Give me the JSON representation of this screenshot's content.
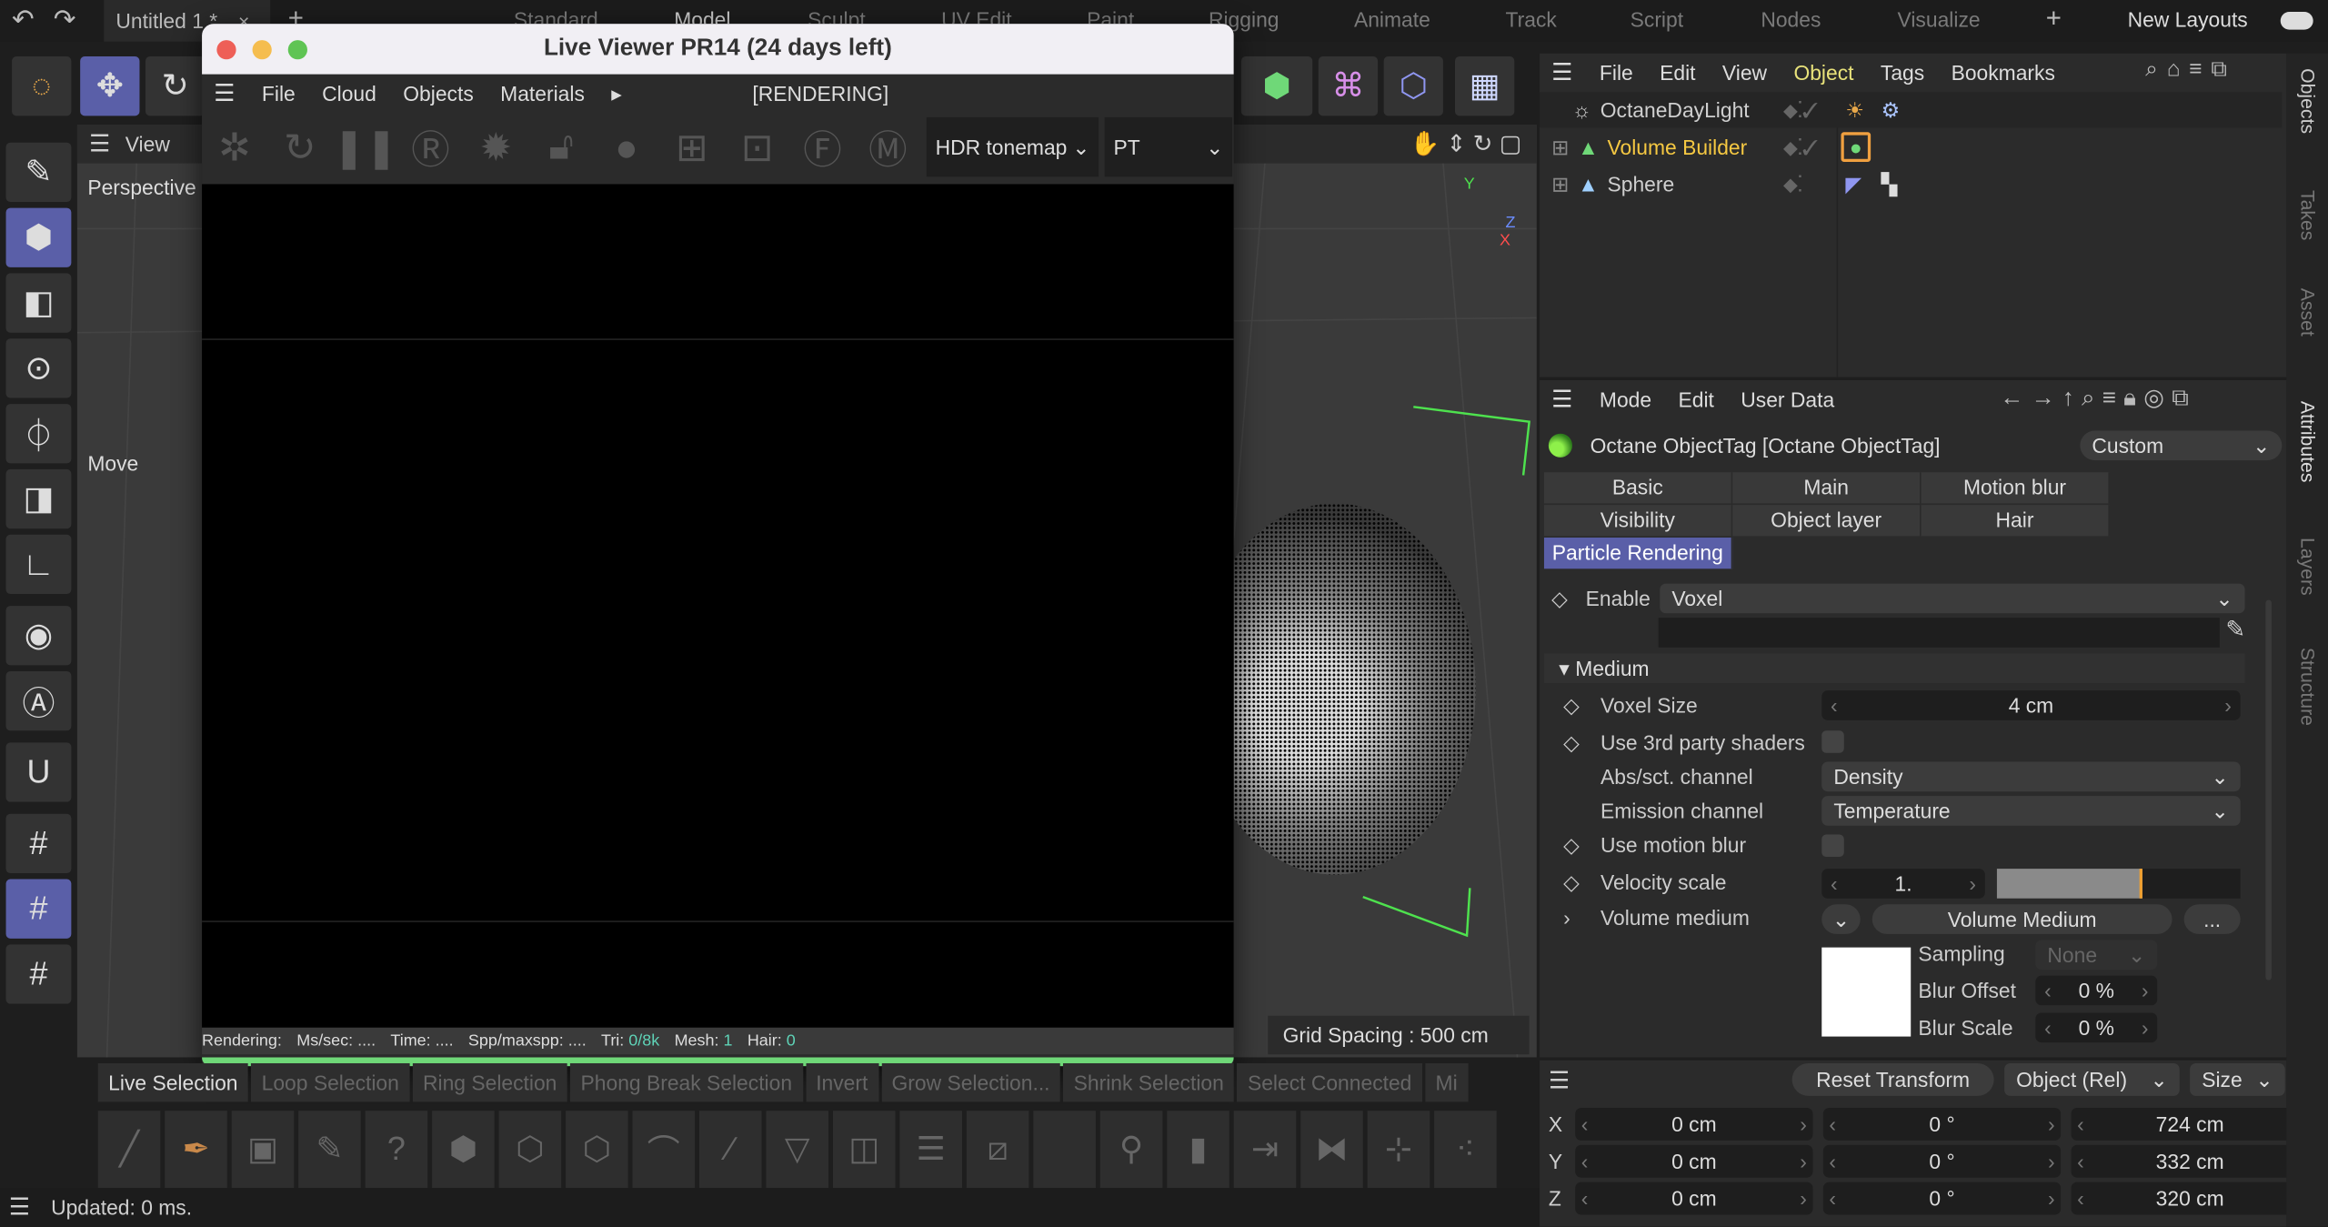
{
  "topbar": {
    "doc_tab": "Untitled 1 *",
    "layouts": [
      "Standard",
      "Model",
      "Sculpt",
      "UV Edit",
      "Paint",
      "Rigging",
      "Animate",
      "Track",
      "Script",
      "Nodes",
      "Visualize"
    ],
    "new_layouts": "New Layouts"
  },
  "viewport": {
    "menu": "View",
    "camera": "Perspective",
    "move_label": "Move",
    "grid_spacing": "Grid Spacing : 500 cm",
    "axis_y": "Y",
    "axis_z": "Z",
    "axis_x": "X"
  },
  "live_viewer": {
    "title": "Live Viewer PR14 (24 days left)",
    "menu": [
      "File",
      "Cloud",
      "Objects",
      "Materials"
    ],
    "state": "[RENDERING]",
    "tonemap": "HDR tonemap",
    "kernel": "PT",
    "status": {
      "rendering": "Rendering:",
      "mssec": "Ms/sec: ....",
      "time": "Time: ....",
      "spp": "Spp/maxspp: ....",
      "tri_label": "Tri:",
      "tri": "0/8k",
      "mesh_label": "Mesh:",
      "mesh": "1",
      "hair_label": "Hair:",
      "hair": "0"
    },
    "progress": 1.0
  },
  "selection_bar": [
    "Live Selection",
    "Loop Selection",
    "Ring Selection",
    "Phong Break Selection",
    "Invert",
    "Grow Selection...",
    "Shrink Selection",
    "Select Connected",
    "Mi"
  ],
  "status_bar": "Updated: 0 ms.",
  "object_manager": {
    "menu": [
      "File",
      "Edit",
      "View",
      "Object",
      "Tags",
      "Bookmarks"
    ],
    "active_menu": "Object",
    "objects": [
      {
        "name": "OctaneDayLight"
      },
      {
        "name": "Volume Builder",
        "selected": true
      },
      {
        "name": "Sphere"
      }
    ]
  },
  "attributes": {
    "menu": [
      "Mode",
      "Edit",
      "User Data"
    ],
    "title": "Octane ObjectTag [Octane ObjectTag]",
    "preset": "Custom",
    "tabs": [
      "Basic",
      "Main",
      "Motion blur",
      "Visibility",
      "Object layer",
      "Hair",
      "Particle Rendering"
    ],
    "active_tab": "Particle Rendering",
    "enable_label": "Enable",
    "enable_value": "Voxel",
    "section": "Medium",
    "voxel_size_label": "Voxel Size",
    "voxel_size": "4 cm",
    "third_party_label": "Use 3rd party shaders",
    "third_party": false,
    "abs_label": "Abs/sct. channel",
    "abs_value": "Density",
    "emission_label": "Emission channel",
    "emission_value": "Temperature",
    "motion_blur_label": "Use motion blur",
    "motion_blur": false,
    "velocity_label": "Velocity scale",
    "velocity": "1.",
    "velocity_slider": 0.6,
    "volume_medium_label": "Volume medium",
    "volume_medium_btn": "Volume Medium",
    "more": "...",
    "sampling_label": "Sampling",
    "sampling": "None",
    "blur_offset_label": "Blur Offset",
    "blur_offset": "0 %",
    "blur_scale_label": "Blur Scale",
    "blur_scale": "0 %"
  },
  "coordinates": {
    "reset": "Reset Transform",
    "mode": "Object (Rel)",
    "size_mode": "Size",
    "rows": [
      {
        "axis": "X",
        "pos": "0 cm",
        "rot": "0 °",
        "size": "724 cm"
      },
      {
        "axis": "Y",
        "pos": "0 cm",
        "rot": "0 °",
        "size": "332 cm"
      },
      {
        "axis": "Z",
        "pos": "0 cm",
        "rot": "0 °",
        "size": "320 cm"
      }
    ]
  },
  "side_tabs": [
    "Objects",
    "Takes",
    "Asset",
    "Attributes",
    "Layers",
    "Structure"
  ],
  "colors": {
    "accent": "#5a5fa8",
    "progress": "#6fd878",
    "selected_object": "#f5c842",
    "active_menu": "#e8e27a"
  }
}
